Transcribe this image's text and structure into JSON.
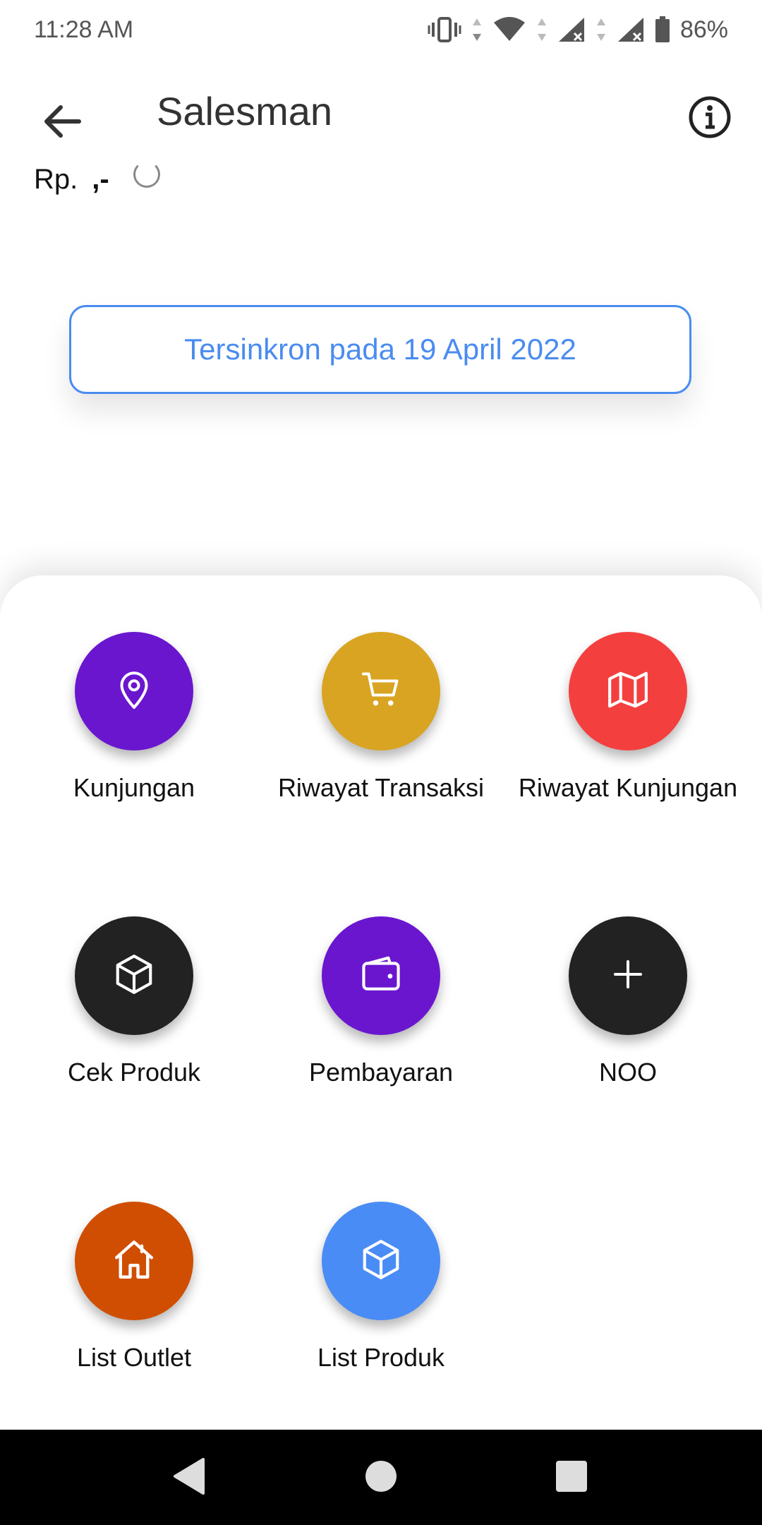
{
  "status_bar": {
    "time": "11:28 AM",
    "battery": "86%"
  },
  "app_bar": {
    "title": "Salesman",
    "back_icon": "arrow-left-icon",
    "info_icon": "info-icon"
  },
  "balance": {
    "prefix": "Rp.",
    "amount": ",-"
  },
  "sync": {
    "label": "Tersinkron pada 19 April 2022"
  },
  "colors": {
    "purple": "#6a16cf",
    "gold": "#d9a422",
    "red": "#f43f3f",
    "dark": "#222222",
    "orange": "#d04e02",
    "blue": "#4a8cf5",
    "sync_border": "#4a8cf0"
  },
  "menu": {
    "items": [
      {
        "label": "Kunjungan",
        "icon": "map-pin-icon",
        "color": "#6a16cf"
      },
      {
        "label": "Riwayat Transaksi",
        "icon": "shopping-cart-icon",
        "color": "#d9a422"
      },
      {
        "label": "Riwayat Kunjungan",
        "icon": "map-icon",
        "color": "#f43f3f"
      },
      {
        "label": "Cek Produk",
        "icon": "box-icon",
        "color": "#222222"
      },
      {
        "label": "Pembayaran",
        "icon": "wallet-icon",
        "color": "#6a16cf"
      },
      {
        "label": "NOO",
        "icon": "plus-icon",
        "color": "#222222"
      },
      {
        "label": "List Outlet",
        "icon": "home-icon",
        "color": "#d04e02"
      },
      {
        "label": "List Produk",
        "icon": "box-icon",
        "color": "#4a8cf5"
      }
    ]
  }
}
